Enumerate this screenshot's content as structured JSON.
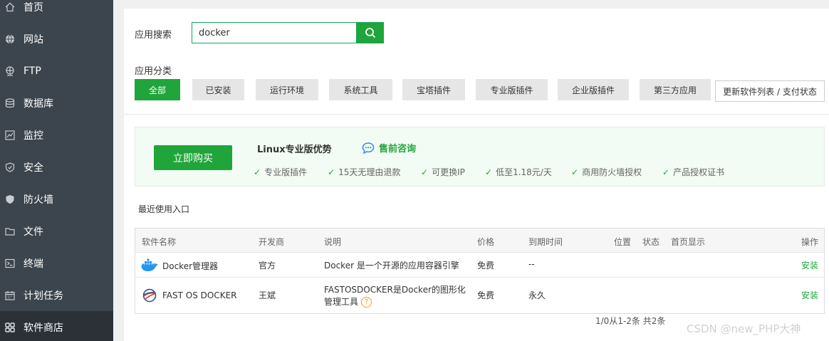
{
  "sidebar": {
    "items": [
      {
        "label": "首页",
        "icon": "home-icon"
      },
      {
        "label": "网站",
        "icon": "globe-icon"
      },
      {
        "label": "FTP",
        "icon": "ftp-icon"
      },
      {
        "label": "数据库",
        "icon": "database-icon"
      },
      {
        "label": "监控",
        "icon": "monitor-chart-icon"
      },
      {
        "label": "安全",
        "icon": "shield-icon"
      },
      {
        "label": "防火墙",
        "icon": "firewall-shield-icon"
      },
      {
        "label": "文件",
        "icon": "folder-icon"
      },
      {
        "label": "终端",
        "icon": "terminal-icon"
      },
      {
        "label": "计划任务",
        "icon": "calendar-icon"
      },
      {
        "label": "软件商店",
        "icon": "apps-grid-icon",
        "active": true
      }
    ]
  },
  "search": {
    "label": "应用搜索",
    "value": "docker",
    "button_icon": "search-icon"
  },
  "categories": {
    "label": "应用分类",
    "items": [
      "全部",
      "已安装",
      "运行环境",
      "系统工具",
      "宝塔插件",
      "专业版插件",
      "企业版插件",
      "第三方应用"
    ],
    "active_index": 0,
    "update_button": "更新软件列表 / 支付状态"
  },
  "promo": {
    "buy_button": "立即购买",
    "title": "Linux专业版优势",
    "consult": "售前咨询",
    "benefits": [
      "专业版插件",
      "15天无理由退款",
      "可更换IP",
      "低至1.18元/天",
      "商用防火墙授权",
      "产品授权证书"
    ]
  },
  "recent": {
    "label": "最近使用入口"
  },
  "table": {
    "headers": [
      "软件名称",
      "开发商",
      "说明",
      "价格",
      "到期时间",
      "位置",
      "状态",
      "首页显示",
      "操作"
    ],
    "rows": [
      {
        "name": "Docker管理器",
        "developer": "官方",
        "desc": "Docker 是一个开源的应用容器引擎",
        "price": "免费",
        "expiry": "--",
        "action": "安装"
      },
      {
        "name": "FAST OS DOCKER",
        "developer": "王斌",
        "desc_line1": "FASTOSDOCKER是Docker的图形化",
        "desc_line2": "管理工具",
        "price": "免费",
        "expiry": "永久",
        "action": "安装"
      }
    ]
  },
  "pager": {
    "text": "1/0从1-2条 共2条"
  },
  "watermark": "CSDN @new_PHP大神",
  "colors": {
    "accent": "#20a53a",
    "sidebar_bg": "#3c444d",
    "sidebar_active_bg": "#2c3138"
  }
}
